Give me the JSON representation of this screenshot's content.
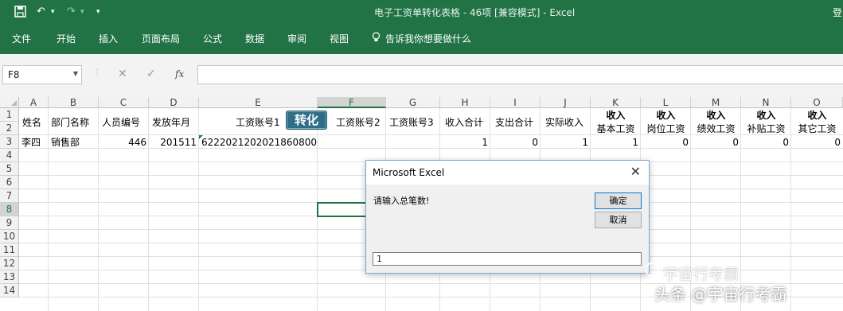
{
  "window": {
    "title": "电子工资单转化表格 - 46项  [兼容模式]  -  Excel",
    "login_label": "登",
    "quick_access": {
      "save_icon": "save-icon",
      "undo_icon": "undo-icon",
      "redo_icon": "redo-icon",
      "customize_icon": "customize-icon"
    }
  },
  "ribbon": {
    "tabs": [
      "文件",
      "开始",
      "插入",
      "页面布局",
      "公式",
      "数据",
      "审阅",
      "视图"
    ],
    "tell_me": "告诉我你想要做什么"
  },
  "formula_bar": {
    "name_box": "F8",
    "cancel_glyph": "✕",
    "enter_glyph": "✓",
    "fx_label": "fx",
    "value": ""
  },
  "sheet": {
    "columns": [
      "A",
      "B",
      "C",
      "D",
      "E",
      "F",
      "G",
      "H",
      "I",
      "J",
      "K",
      "L",
      "M",
      "N",
      "O"
    ],
    "rows": [
      "1",
      "2",
      "3",
      "4",
      "5",
      "6",
      "7",
      "8",
      "9",
      "10",
      "11",
      "12",
      "13",
      "14"
    ],
    "selected_cell": "F8",
    "header_row": {
      "A": "姓名",
      "B": "部门名称",
      "C": "人员编号",
      "D": "发放年月",
      "E": "工资账号1",
      "F": "工资账号2",
      "G": "工资账号3",
      "H": "收入合计",
      "I": "支出合计",
      "J": "实际收入",
      "K_top": "收入",
      "K_bottom": "基本工资",
      "L_top": "收入",
      "L_bottom": "岗位工资",
      "M_top": "收入",
      "M_bottom": "绩效工资",
      "N_top": "收入",
      "N_bottom": "补贴工资",
      "O_top": "收入",
      "O_bottom": "其它工资"
    },
    "data_row": {
      "A": "李四",
      "B": "销售部",
      "C": "446",
      "D": "201511",
      "E": "6222021202021860800",
      "H": "1",
      "I": "0",
      "J": "1",
      "K": "1",
      "L": "0",
      "M": "0",
      "N": "0",
      "O": "0"
    },
    "convert_button": "转化"
  },
  "dialog": {
    "title": "Microsoft Excel",
    "close_glyph": "✕",
    "message": "请输入总笔数!",
    "ok_label": "确定",
    "cancel_label": "取消",
    "input_value": "1"
  },
  "watermark": {
    "line1": "宇宙行考霸",
    "line2": "头条 @宇宙行考霸"
  },
  "colors": {
    "excel_green": "#217346",
    "convert_button": "#2e6e87"
  }
}
